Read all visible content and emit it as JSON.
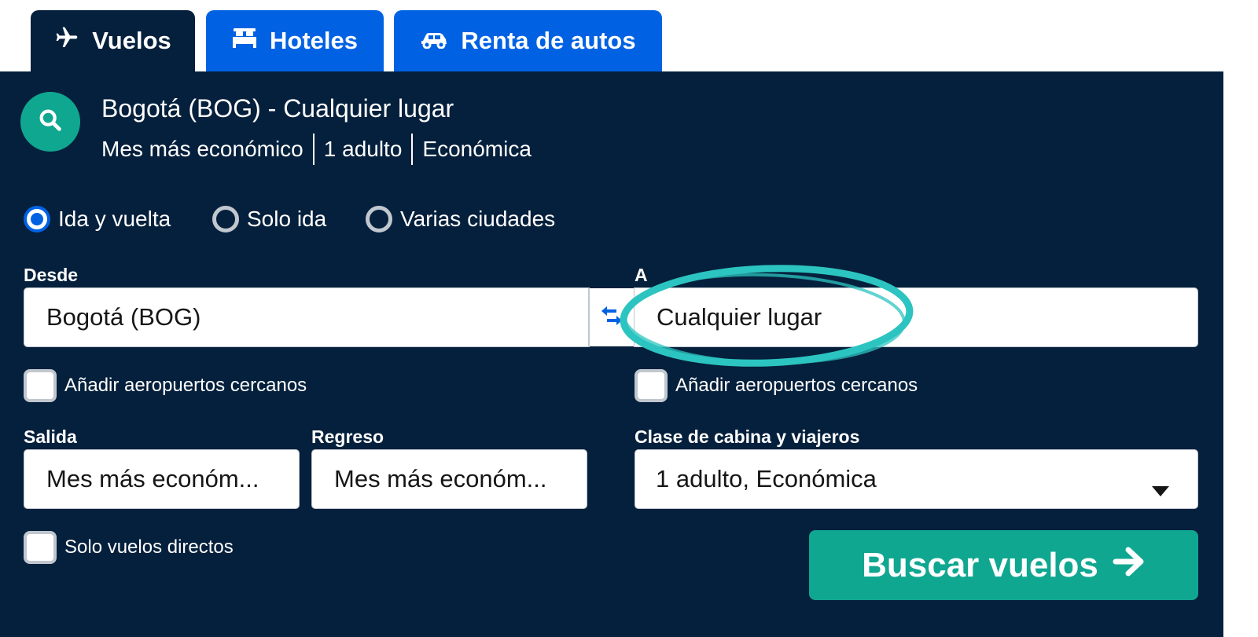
{
  "tabs": [
    {
      "label": "Vuelos",
      "icon": "plane-icon",
      "active": true
    },
    {
      "label": "Hoteles",
      "icon": "bed-icon",
      "active": false
    },
    {
      "label": "Renta de autos",
      "icon": "car-icon",
      "active": false
    }
  ],
  "summary": {
    "title": "Bogotá (BOG) - Cualquier lugar",
    "date": "Mes más económico",
    "travelers": "1 adulto",
    "cabin": "Económica"
  },
  "trip_types": [
    {
      "label": "Ida y vuelta",
      "selected": true
    },
    {
      "label": "Solo ida",
      "selected": false
    },
    {
      "label": "Varias ciudades",
      "selected": false
    }
  ],
  "from": {
    "label": "Desde",
    "value": "Bogotá (BOG)"
  },
  "to": {
    "label": "A",
    "value": "Cualquier lugar"
  },
  "nearby": {
    "from_label": "Añadir aeropuertos cercanos",
    "to_label": "Añadir aeropuertos cercanos"
  },
  "depart": {
    "label": "Salida",
    "value": "Mes más económ..."
  },
  "return": {
    "label": "Regreso",
    "value": "Mes más económ..."
  },
  "cabin": {
    "label": "Clase de cabina y viajeros",
    "value": "1 adulto, Económica"
  },
  "direct": {
    "label": "Solo vuelos directos"
  },
  "search_button": {
    "label": "Buscar vuelos"
  },
  "colors": {
    "panel": "#05203c",
    "tab_inactive": "#0062e3",
    "accent": "#10a791",
    "highlight": "#2cc4c0"
  }
}
